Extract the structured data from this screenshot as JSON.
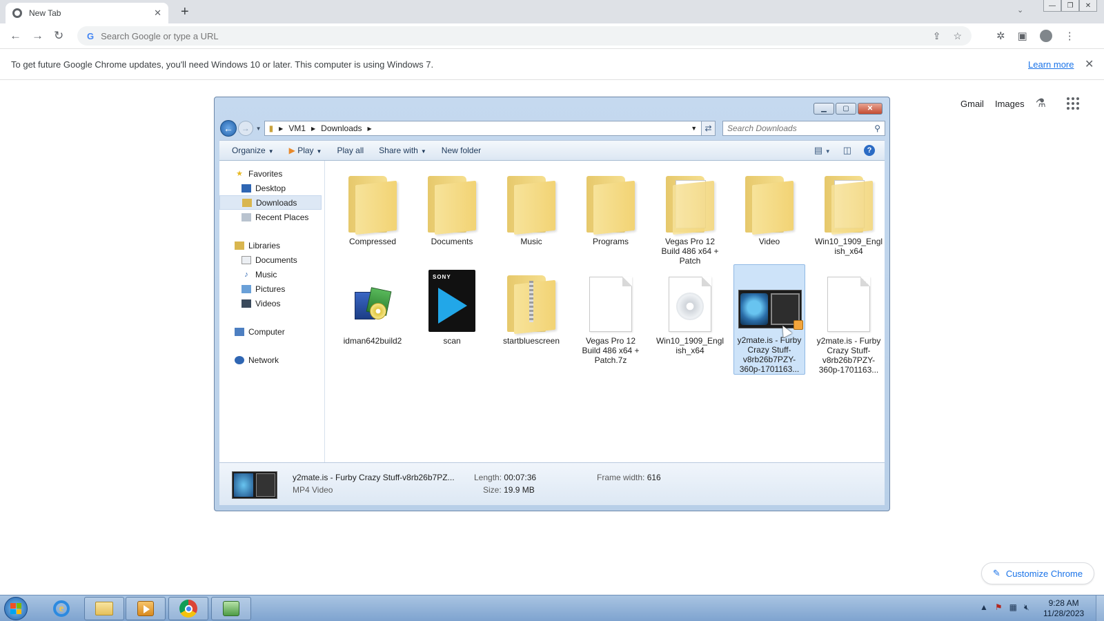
{
  "browser": {
    "tab_title": "New Tab",
    "omnibox_placeholder": "Search Google or type a URL",
    "infobar": {
      "message": "To get future Google Chrome updates, you'll need Windows 10 or later. This computer is using Windows 7.",
      "learn_more": "Learn more"
    },
    "ntp": {
      "gmail": "Gmail",
      "images": "Images",
      "customize": "Customize Chrome"
    }
  },
  "explorer": {
    "breadcrumb": [
      "VM1",
      "Downloads"
    ],
    "search_placeholder": "Search Downloads",
    "commands": {
      "organize": "Organize",
      "play": "Play",
      "play_all": "Play all",
      "share_with": "Share with",
      "new_folder": "New folder"
    },
    "nav": {
      "favorites": "Favorites",
      "desktop": "Desktop",
      "downloads": "Downloads",
      "recent": "Recent Places",
      "libraries": "Libraries",
      "documents": "Documents",
      "music": "Music",
      "pictures": "Pictures",
      "videos": "Videos",
      "computer": "Computer",
      "network": "Network"
    },
    "items": [
      {
        "label": "Compressed",
        "icon": "folder-icon"
      },
      {
        "label": "Documents",
        "icon": "folder-icon"
      },
      {
        "label": "Music",
        "icon": "folder-icon"
      },
      {
        "label": "Programs",
        "icon": "folder-icon"
      },
      {
        "label": "Vegas Pro 12 Build 486 x64 + Patch",
        "icon": "folder-icon"
      },
      {
        "label": "Video",
        "icon": "folder-icon"
      },
      {
        "label": "Win10_1909_English_x64",
        "icon": "folder-icon"
      },
      {
        "label": "idman642build2",
        "icon": "installer-icon"
      },
      {
        "label": "scan",
        "icon": "sony-vegas-icon"
      },
      {
        "label": "startbluescreen",
        "icon": "zip-folder-icon"
      },
      {
        "label": "Vegas Pro 12 Build 486 x64 + Patch.7z",
        "icon": "file-icon"
      },
      {
        "label": "Win10_1909_English_x64",
        "icon": "disc-image-icon"
      },
      {
        "label": "y2mate.is - Furby Crazy Stuff-v8rb26b7PZY-360p-1701163...",
        "icon": "video-thumbnail-icon"
      },
      {
        "label": "y2mate.is - Furby Crazy Stuff-v8rb26b7PZY-360p-1701163...",
        "icon": "file-icon"
      }
    ],
    "details": {
      "name": "y2mate.is - Furby Crazy Stuff-v8rb26b7PZ...",
      "type": "MP4 Video",
      "length_label": "Length:",
      "length_value": "00:07:36",
      "size_label": "Size:",
      "size_value": "19.9 MB",
      "frame_width_label": "Frame width:",
      "frame_width_value": "616"
    }
  },
  "taskbar": {
    "time": "9:28 AM",
    "date": "11/28/2023"
  }
}
